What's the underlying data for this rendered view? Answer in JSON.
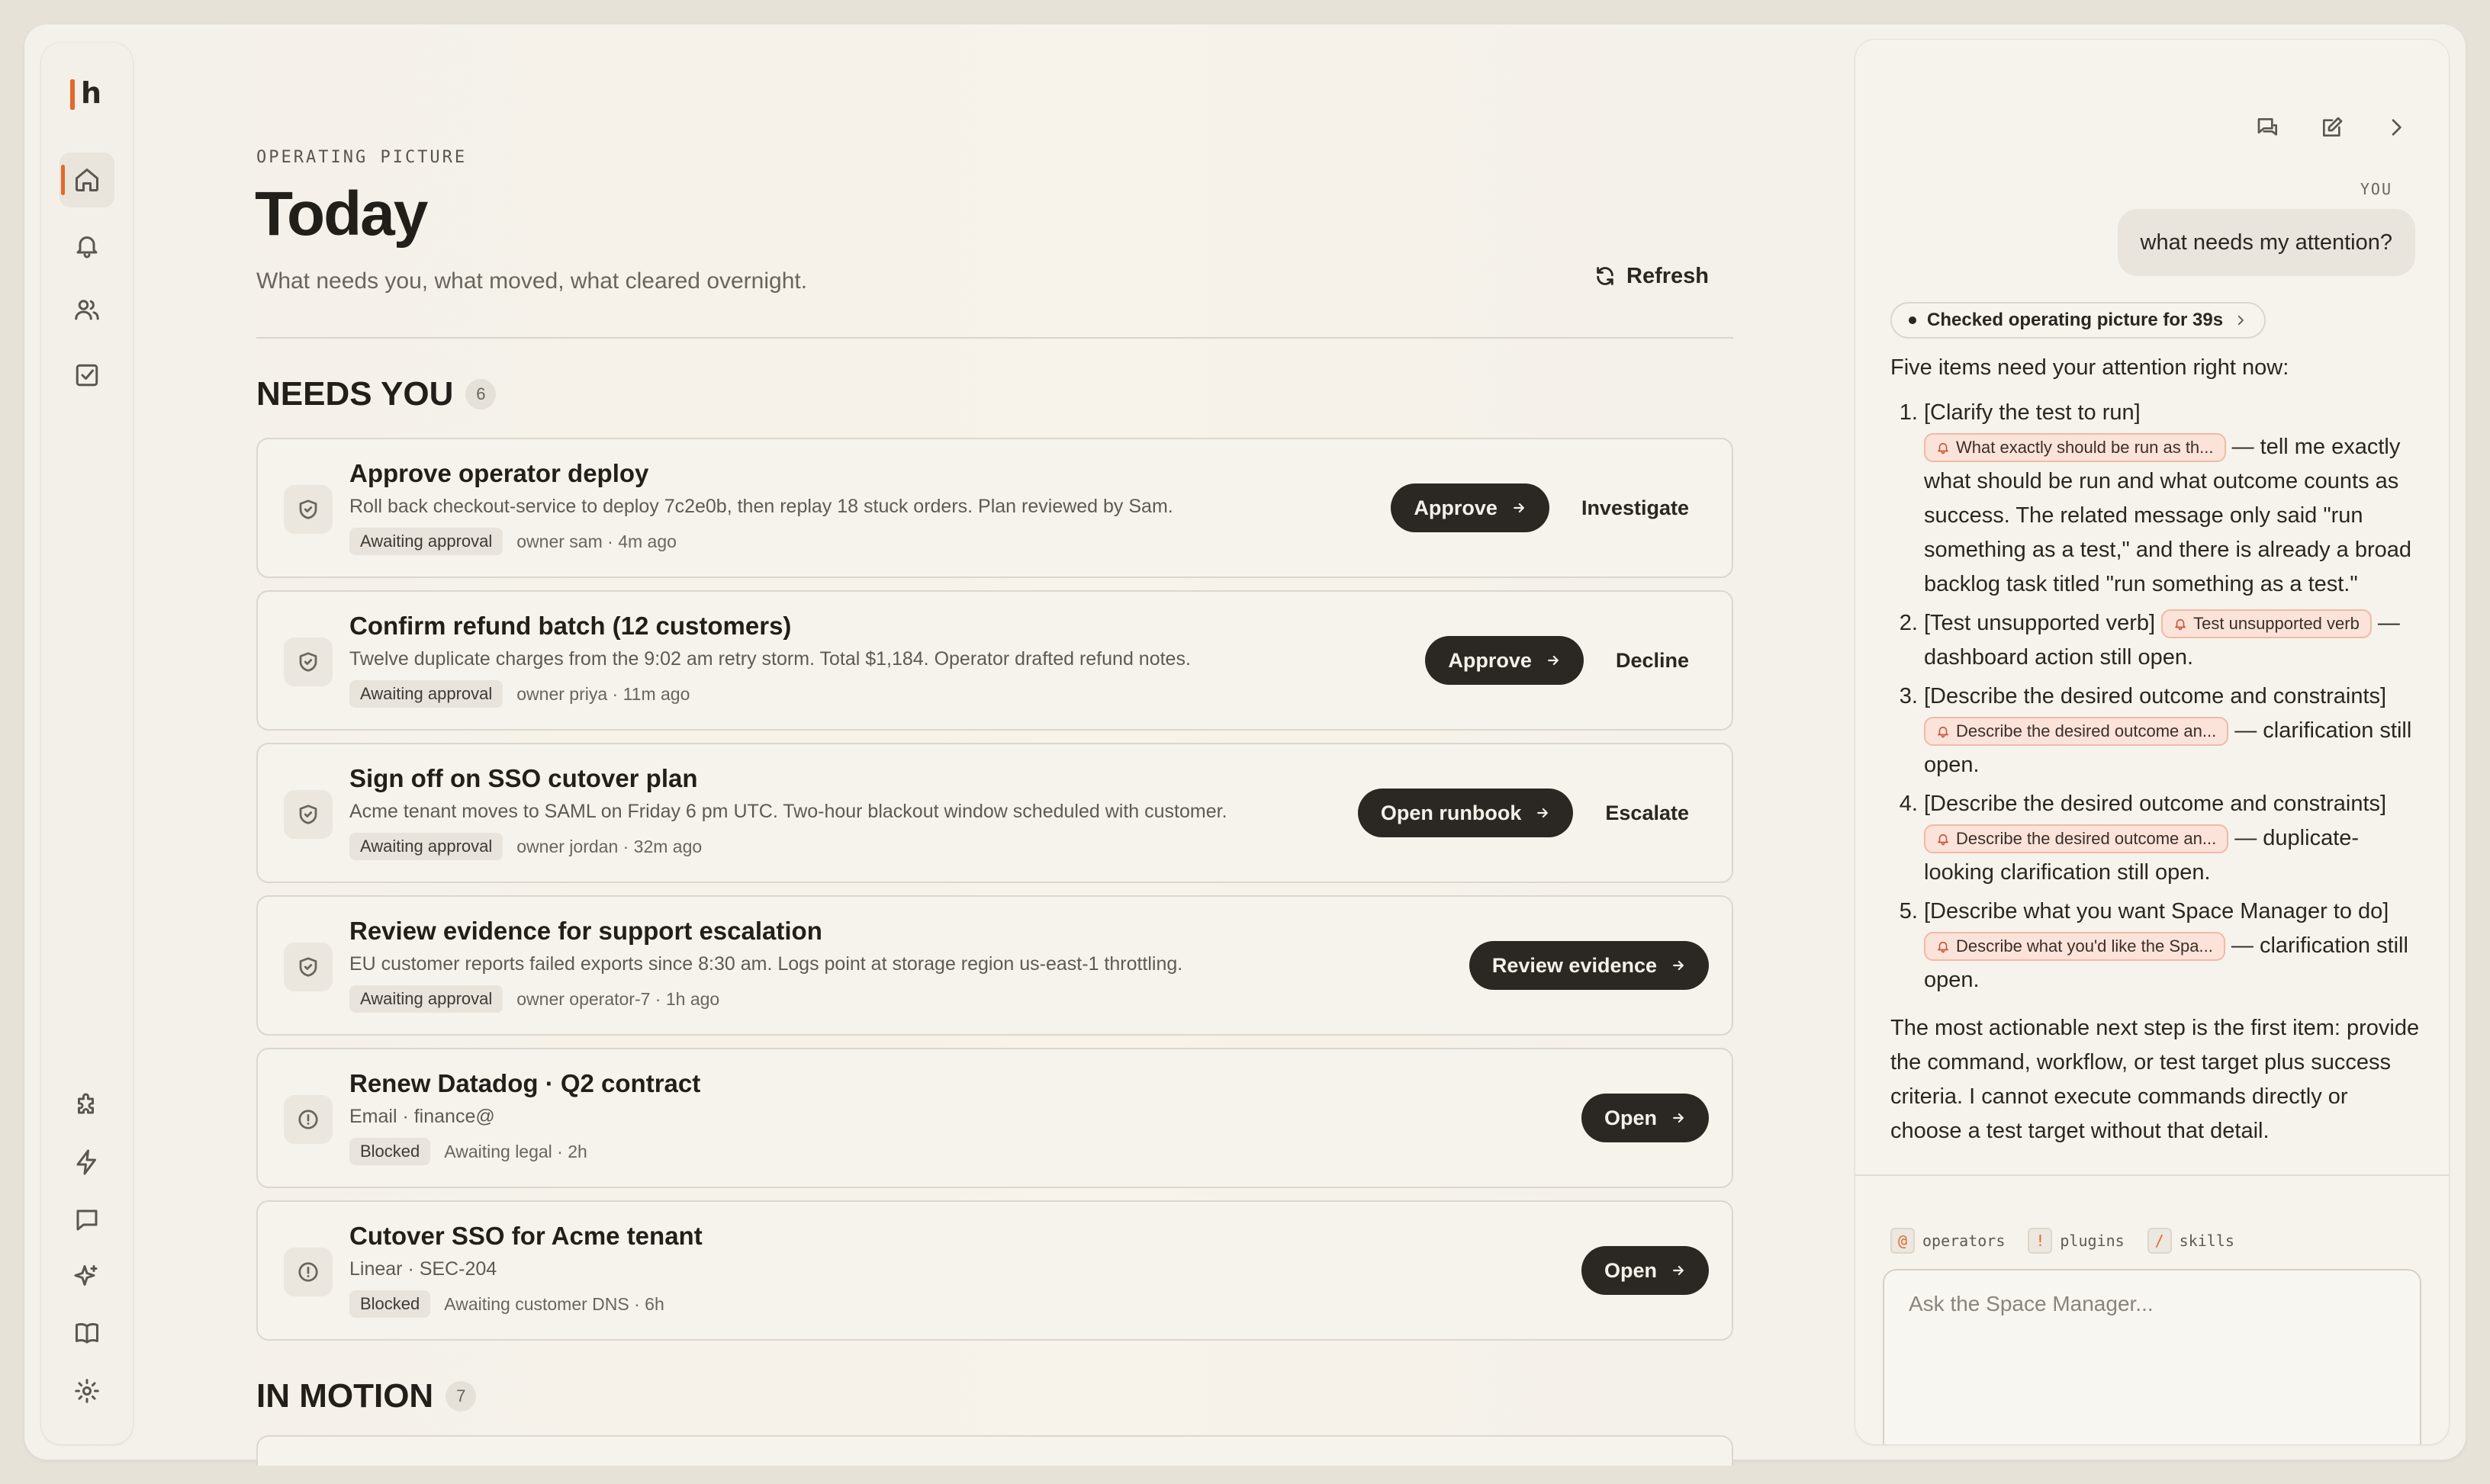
{
  "app": {
    "logo_text": "h"
  },
  "sidebar": {
    "top_items": [
      {
        "name": "home",
        "icon": "home-icon",
        "active": true
      },
      {
        "name": "notifications",
        "icon": "bell-icon"
      },
      {
        "name": "people",
        "icon": "users-icon"
      },
      {
        "name": "tasks",
        "icon": "checkbox-icon"
      }
    ],
    "bottom_items": [
      {
        "name": "plugins",
        "icon": "puzzle-icon"
      },
      {
        "name": "automations",
        "icon": "lightning-icon"
      },
      {
        "name": "messages",
        "icon": "chat-icon"
      },
      {
        "name": "skills",
        "icon": "sparkles-icon"
      },
      {
        "name": "docs",
        "icon": "book-icon"
      },
      {
        "name": "settings",
        "icon": "gear-icon"
      }
    ]
  },
  "header": {
    "eyebrow": "OPERATING PICTURE",
    "title": "Today",
    "subtitle": "What needs you, what moved, what cleared overnight.",
    "refresh_label": "Refresh"
  },
  "needs_you": {
    "title": "NEEDS YOU",
    "count": "6",
    "cards": [
      {
        "title": "Approve operator deploy",
        "desc": "Roll back checkout-service to deploy 7c2e0b, then replay 18 stuck orders. Plan reviewed by Sam.",
        "tag": "Awaiting approval",
        "meta": "owner sam · 4m ago",
        "primary": "Approve",
        "secondary": "Investigate",
        "icon": "shield-icon"
      },
      {
        "title": "Confirm refund batch (12 customers)",
        "desc": "Twelve duplicate charges from the 9:02 am retry storm. Total $1,184. Operator drafted refund notes.",
        "tag": "Awaiting approval",
        "meta": "owner priya · 11m ago",
        "primary": "Approve",
        "secondary": "Decline",
        "icon": "shield-icon"
      },
      {
        "title": "Sign off on SSO cutover plan",
        "desc": "Acme tenant moves to SAML on Friday 6 pm UTC. Two-hour blackout window scheduled with customer.",
        "tag": "Awaiting approval",
        "meta": "owner jordan · 32m ago",
        "primary": "Open runbook",
        "secondary": "Escalate",
        "icon": "shield-icon"
      },
      {
        "title": "Review evidence for support escalation",
        "desc": "EU customer reports failed exports since 8:30 am. Logs point at storage region us-east-1 throttling.",
        "tag": "Awaiting approval",
        "meta": "owner operator-7 · 1h ago",
        "primary": "Review evidence",
        "secondary": "",
        "icon": "shield-icon"
      },
      {
        "title": "Renew Datadog · Q2 contract",
        "desc": "Email · finance@",
        "tag": "Blocked",
        "meta": "Awaiting legal · 2h",
        "primary": "Open",
        "secondary": "",
        "icon": "alert-circle-icon"
      },
      {
        "title": "Cutover SSO for Acme tenant",
        "desc": "Linear · SEC-204",
        "tag": "Blocked",
        "meta": "Awaiting customer DNS · 6h",
        "primary": "Open",
        "secondary": "",
        "icon": "alert-circle-icon"
      }
    ]
  },
  "in_motion": {
    "title": "IN MOTION",
    "count": "7"
  },
  "assistant": {
    "you_label": "YOU",
    "user_message": "what needs my attention?",
    "checked_label": "Checked operating picture for 39s",
    "intro": "Five items need your attention right now:",
    "items": [
      {
        "lead": "[Clarify the test to run]",
        "chip": "What exactly should be run as th...",
        "text": " — tell me exactly what should be run and what outcome counts as success. The related message only said \"run something as a test,\" and there is already a broad backlog task titled \"run something as a test.\""
      },
      {
        "lead": "[Test unsupported verb]",
        "chip": "Test unsupported verb",
        "text": " — dashboard action still open."
      },
      {
        "lead": "[Describe the desired outcome and constraints]",
        "chip": "Describe the desired outcome an...",
        "text": " — clarification still open."
      },
      {
        "lead": "[Describe the desired outcome and constraints]",
        "chip": "Describe the desired outcome an...",
        "text": " — duplicate-looking clarification still open."
      },
      {
        "lead": "[Describe what you want Space Manager to do]",
        "chip": "Describe what you'd like the Spa...",
        "text": " — clarification still open."
      }
    ],
    "outro": "The most actionable next step is the first item: provide the command, workflow, or test target plus success criteria. I cannot execute commands directly or choose a test target without that detail.",
    "hints": [
      {
        "key": "@",
        "label": "operators"
      },
      {
        "key": "!",
        "label": "plugins"
      },
      {
        "key": "/",
        "label": "skills"
      }
    ],
    "composer_placeholder": "Ask the Space Manager..."
  },
  "colors": {
    "accent": "#e06a2c",
    "dark_button": "#2b2722",
    "chip_bg": "#fbe3da"
  }
}
